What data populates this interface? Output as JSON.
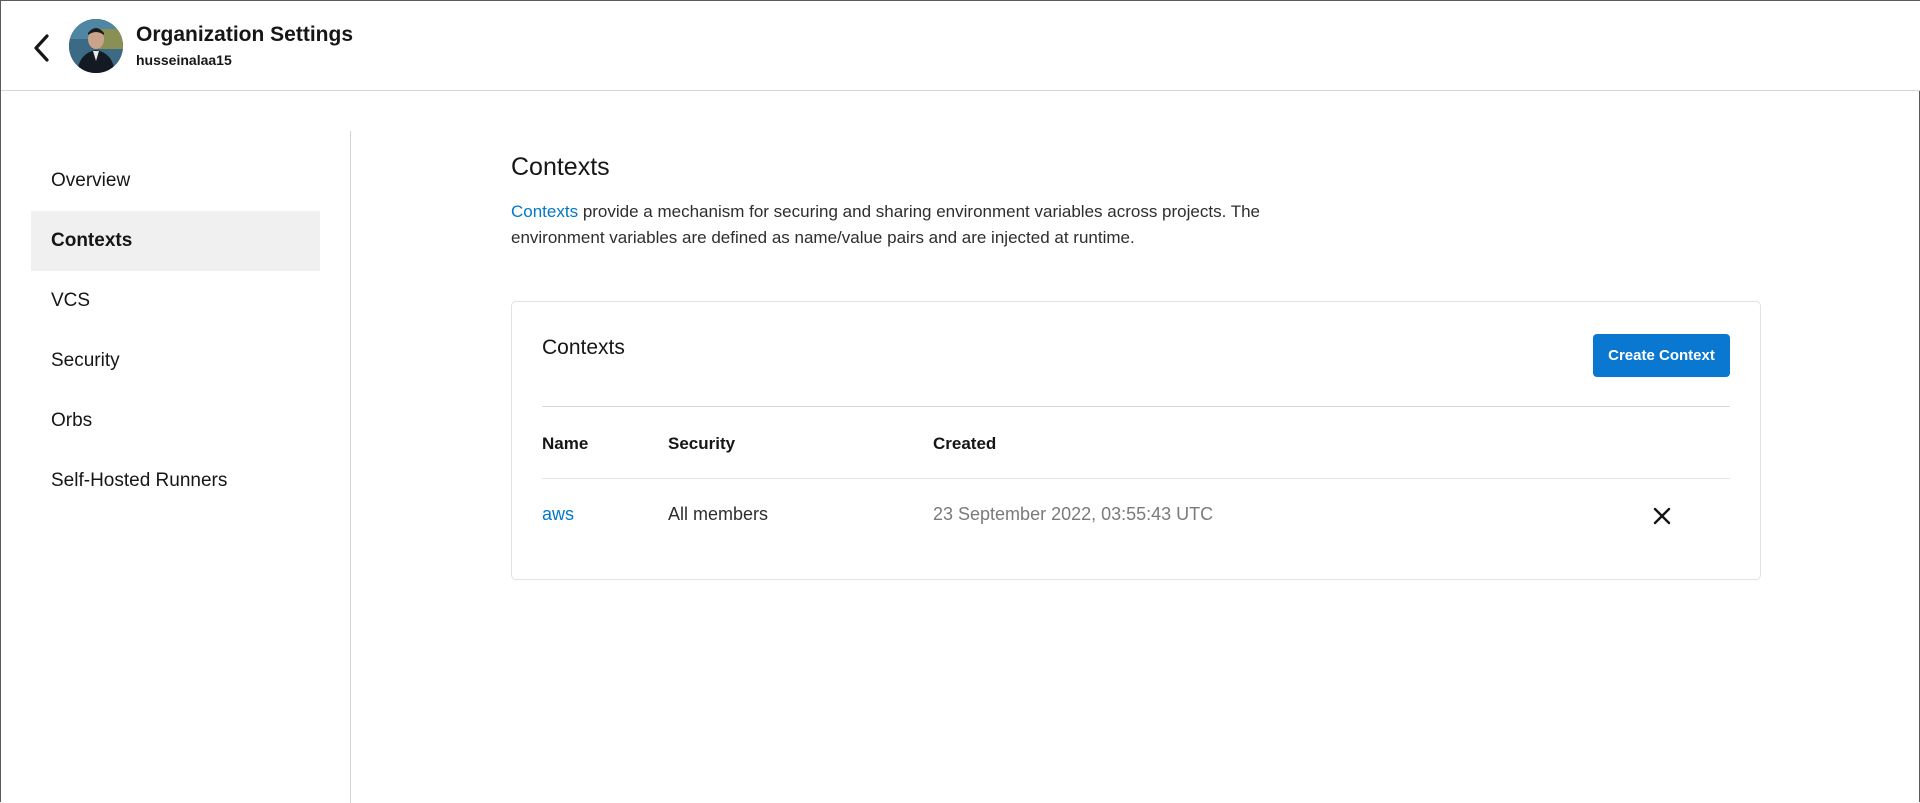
{
  "header": {
    "title": "Organization Settings",
    "username": "husseinalaa15",
    "icons": {
      "back": "chevron-left-icon",
      "avatar": "user-avatar"
    }
  },
  "sidebar": {
    "items": [
      {
        "label": "Overview",
        "active": false
      },
      {
        "label": "Contexts",
        "active": true
      },
      {
        "label": "VCS",
        "active": false
      },
      {
        "label": "Security",
        "active": false
      },
      {
        "label": "Orbs",
        "active": false
      },
      {
        "label": "Self-Hosted Runners",
        "active": false
      }
    ]
  },
  "main": {
    "title": "Contexts",
    "description_link": "Contexts",
    "description_rest": " provide a mechanism for securing and sharing environment variables across projects. The environment variables are defined as name/value pairs and are injected at runtime."
  },
  "card": {
    "title": "Contexts",
    "create_button": "Create Context",
    "columns": [
      "Name",
      "Security",
      "Created"
    ],
    "rows": [
      {
        "name": "aws",
        "security": "All members",
        "created": "23 September 2022, 03:55:43 UTC",
        "action_icon": "close-icon"
      }
    ]
  },
  "colors": {
    "accent": "#0a78d0",
    "link": "#0078c9",
    "active_bg": "#f0f0f0"
  }
}
